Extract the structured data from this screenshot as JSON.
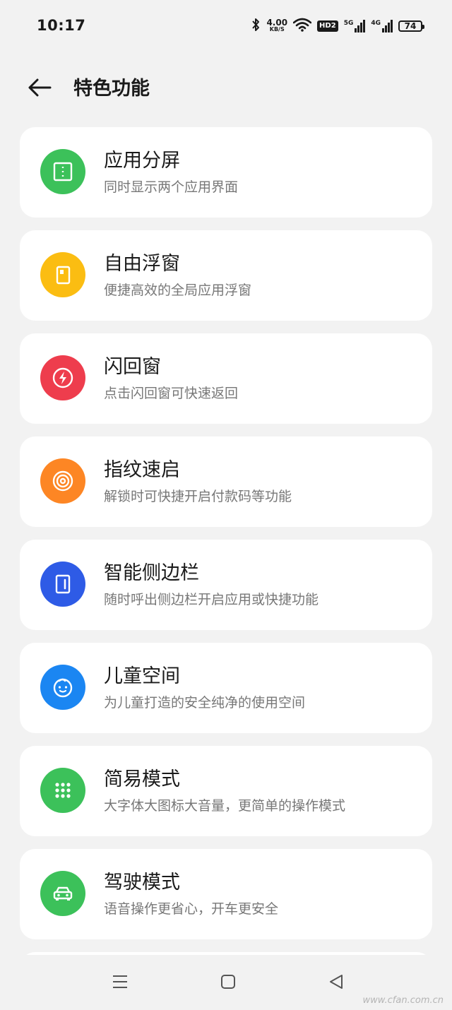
{
  "status": {
    "time": "10:17",
    "net_speed_value": "4.00",
    "net_speed_unit": "KB/S",
    "hd_badge": "HD2",
    "sim1_label": "5G",
    "sim2_label": "4G",
    "battery": "74"
  },
  "header": {
    "title": "特色功能"
  },
  "items": [
    {
      "title": "应用分屏",
      "subtitle": "同时显示两个应用界面",
      "color": "#3cc15a",
      "icon": "split-screen-icon"
    },
    {
      "title": "自由浮窗",
      "subtitle": "便捷高效的全局应用浮窗",
      "color": "#fbbd12",
      "icon": "floating-window-icon"
    },
    {
      "title": "闪回窗",
      "subtitle": "点击闪回窗可快速返回",
      "color": "#ee3d4d",
      "icon": "flash-icon"
    },
    {
      "title": "指纹速启",
      "subtitle": "解锁时可快捷开启付款码等功能",
      "color": "#fd8624",
      "icon": "fingerprint-icon"
    },
    {
      "title": "智能侧边栏",
      "subtitle": "随时呼出侧边栏开启应用或快捷功能",
      "color": "#2e5be6",
      "icon": "sidebar-icon"
    },
    {
      "title": "儿童空间",
      "subtitle": "为儿童打造的安全纯净的使用空间",
      "color": "#1b86f2",
      "icon": "child-face-icon"
    },
    {
      "title": "简易模式",
      "subtitle": "大字体大图标大音量，更简单的操作模式",
      "color": "#3cc15a",
      "icon": "grid-dots-icon"
    },
    {
      "title": "驾驶模式",
      "subtitle": "语音操作更省心，开车更安全",
      "color": "#3cc15a",
      "icon": "car-icon"
    }
  ],
  "watermark": "www.cfan.com.cn"
}
